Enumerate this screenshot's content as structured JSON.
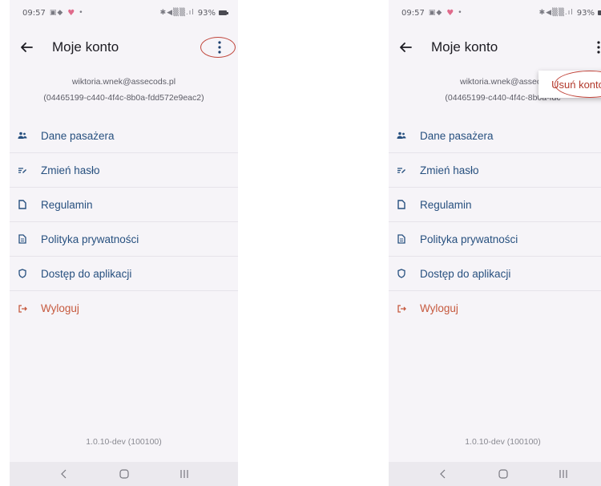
{
  "screens": [
    {
      "status": {
        "time": "09:57",
        "battery": "93%"
      },
      "appbar": {
        "title": "Moje konto"
      },
      "account": {
        "email": "wiktoria.wnek@assecods.pl",
        "id": "(04465199-c440-4f4c-8b0a-fdd572e9eac2)"
      },
      "menu": [
        {
          "label": "Dane pasażera",
          "icon": "people-icon"
        },
        {
          "label": "Zmień hasło",
          "icon": "password-icon"
        },
        {
          "label": "Regulamin",
          "icon": "document-icon"
        },
        {
          "label": "Polityka prywatności",
          "icon": "policy-icon"
        },
        {
          "label": "Dostęp do aplikacji",
          "icon": "shield-icon"
        },
        {
          "label": "Wyloguj",
          "icon": "logout-icon"
        }
      ],
      "version": "1.0.10-dev (100100)"
    },
    {
      "status": {
        "time": "09:57",
        "battery": "93%"
      },
      "appbar": {
        "title": "Moje konto"
      },
      "account": {
        "email": "wiktoria.wnek@asseco",
        "id": "(04465199-c440-4f4c-8b0a-fdc"
      },
      "menu": [
        {
          "label": "Dane pasażera",
          "icon": "people-icon"
        },
        {
          "label": "Zmień hasło",
          "icon": "password-icon"
        },
        {
          "label": "Regulamin",
          "icon": "document-icon"
        },
        {
          "label": "Polityka prywatności",
          "icon": "policy-icon"
        },
        {
          "label": "Dostęp do aplikacji",
          "icon": "shield-icon"
        },
        {
          "label": "Wyloguj",
          "icon": "logout-icon"
        }
      ],
      "version": "1.0.10-dev (100100)",
      "popup": {
        "label": "Usuń konto"
      }
    }
  ],
  "colors": {
    "link": "#27507f",
    "logout": "#c65a3f",
    "annotation": "#c0443a",
    "delete": "#b2382b"
  }
}
